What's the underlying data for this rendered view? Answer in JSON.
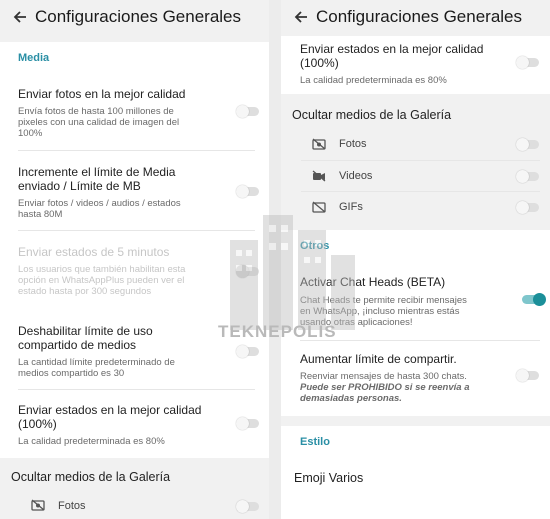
{
  "title": "Configuraciones Generales",
  "left": {
    "section_media": "Media",
    "items": [
      {
        "title": "Enviar fotos en la mejor calidad",
        "desc1": "Envía fotos de hasta 100 millones de",
        "desc2": "pixeles con una calidad de imagen del",
        "desc3": "100%"
      },
      {
        "title1": "Incremente el límite de Media",
        "title2": "enviado / Límite de MB",
        "desc1": "Enviar fotos / videos / audios / estados",
        "desc2": "hasta 80M"
      },
      {
        "title": "Enviar estados de 5 minutos",
        "desc1": "Los usuarios que también habilitan esta",
        "desc2": "opción en WhatsAppPlus pueden ver el",
        "desc3": "estado hasta por 300 segundos"
      },
      {
        "title1": "Deshabilitar límite de uso",
        "title2": "compartido de medios",
        "desc1": "La cantidad límite predeterminado de",
        "desc2": "medios compartido es 30"
      },
      {
        "title1": "Enviar estados en la mejor calidad",
        "title2": "(100%)",
        "desc1": "La calidad predeterminada es 80%"
      }
    ],
    "gallery_header": "Ocultar medios de la Galería",
    "gallery_first": "Fotos"
  },
  "right": {
    "top_item": {
      "title1": "Enviar estados en la mejor calidad",
      "title2": "(100%)",
      "desc": "La calidad predeterminada es 80%"
    },
    "gallery_header": "Ocultar medios de la Galería",
    "gallery_items": [
      "Fotos",
      "Videos",
      "GIFs"
    ],
    "section_otros": "Otros",
    "chat_heads": {
      "title": "Activar Chat Heads (BETA)",
      "desc1": "Chat Heads te permite recibir mensajes",
      "desc2": "en WhatsApp, ¡incluso mientras estás",
      "desc3": "usando otras aplicaciones!"
    },
    "share_limit": {
      "title": "Aumentar límite de compartir.",
      "desc1": "Reenviar mensajes de hasta 300 chats.",
      "desc2": "Puede ser PROHIBIDO si se reenvía a",
      "desc3": "demasiadas personas."
    },
    "section_estilo": "Estilo",
    "emoji": "Emoji Varios"
  },
  "watermark": "TEKNEPOLIS",
  "colors": {
    "accent": "#2a8fa5",
    "toggle_on": "#1b8f99"
  }
}
